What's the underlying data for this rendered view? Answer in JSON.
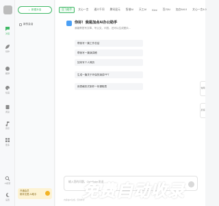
{
  "rail": {
    "items": [
      {
        "label": "对话",
        "icon": "chat-icon"
      },
      {
        "label": "创作",
        "icon": "leaf-icon"
      },
      {
        "label": "翻译",
        "icon": "translate-icon"
      },
      {
        "label": "绘画",
        "icon": "palette-icon"
      },
      {
        "label": "阅读",
        "icon": "book-icon"
      },
      {
        "label": "音乐",
        "icon": "music-icon"
      },
      {
        "label": "更多",
        "icon": "grid-icon"
      },
      {
        "label": "AI搜索",
        "icon": "search-icon"
      },
      {
        "label": "设置",
        "icon": "moon-icon"
      }
    ]
  },
  "conv": {
    "new_chat_label": "新建对话",
    "items": [
      {
        "label": "新的会话"
      }
    ],
    "promo_line1": "开通会员",
    "promo_line2": "畅享无限 AI助手"
  },
  "tabs": [
    "豆飞助手",
    "文心一言",
    "通义千问",
    "腾讯混元",
    "智谱AI",
    "天工AI",
    "Kimi",
    "百川AI",
    "加点AI4.0",
    "文心一言4.0"
  ],
  "active_tab": 0,
  "bot": {
    "greeting": "你好！我是加点AI办公助手",
    "intro": "我能帮您写文章、写公文、问答，还可以生成图片...",
    "suggestions": [
      "帮我写一篇工作总结",
      "帮我写一篇演讲稿",
      "如何写个人简历",
      "生成一篇关于环保的演讲PPT",
      "用表格形式制作一份课程表"
    ]
  },
  "input": {
    "placeholder": "输入您的问题，Ctrl+Enter发送",
    "footer": "内容由AI生成，仅供参考"
  },
  "side_tools": [
    "常用",
    "反馈"
  ],
  "watermark": "免费自动收录",
  "colors": {
    "accent": "#3fb865",
    "promo_bg": "#fdf3d4"
  }
}
